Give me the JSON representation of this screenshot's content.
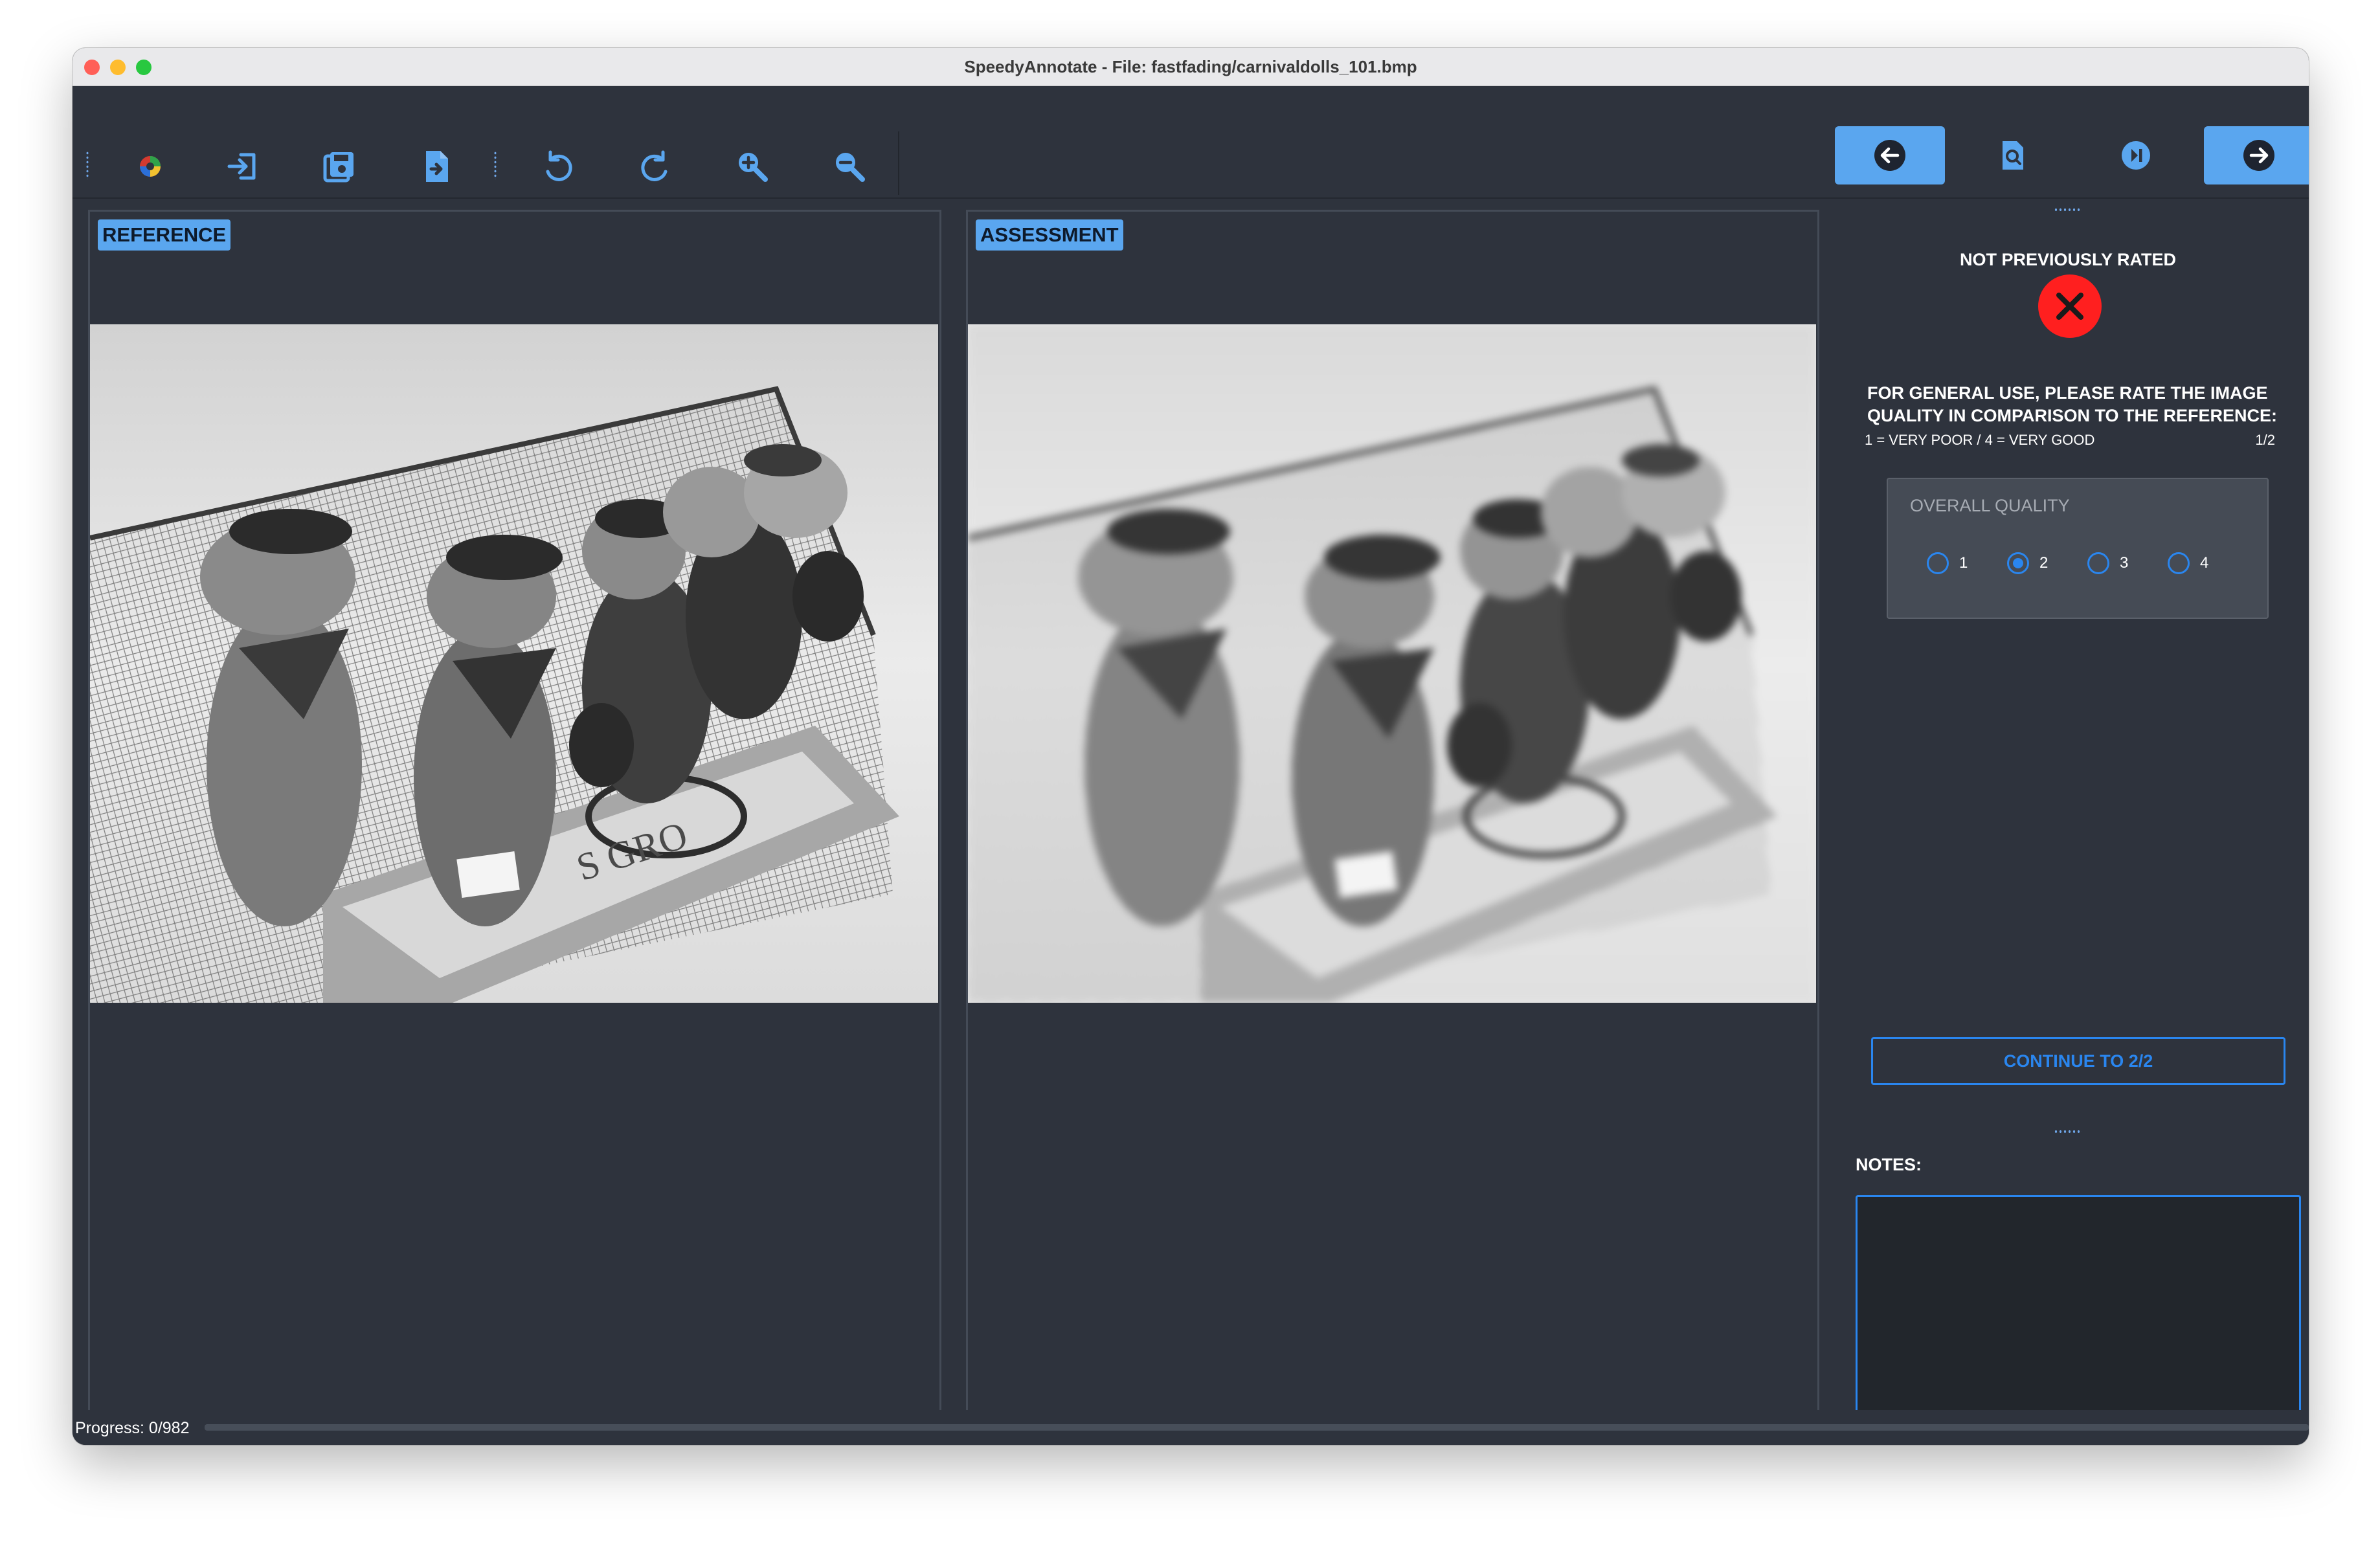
{
  "window": {
    "title": "SpeedyAnnotate - File: fastfading/carnivaldolls_101.bmp"
  },
  "toolbar": {
    "left_icons": [
      "app-logo-icon",
      "import-icon",
      "save-icon",
      "export-file-icon",
      "rotate-left-icon",
      "rotate-right-icon",
      "zoom-in-icon",
      "zoom-out-icon"
    ],
    "nav_buttons": [
      "arrow-left-icon",
      "search-icon",
      "skip-next-icon",
      "arrow-right-icon"
    ]
  },
  "reference": {
    "label": "REFERENCE",
    "progress": 0.8
  },
  "assessment": {
    "label": "ASSESSMENT",
    "progress": 0.8
  },
  "rating": {
    "status": "NOT PREVIOUSLY RATED",
    "prompt": "FOR GENERAL USE, PLEASE RATE THE IMAGE QUALITY IN COMPARISON TO THE REFERENCE:",
    "scale": "1 = VERY POOR  /  4 = VERY GOOD",
    "step": "1/2",
    "group_label": "OVERALL QUALITY",
    "options": [
      "1",
      "2",
      "3",
      "4"
    ],
    "selected": "2",
    "continue_label": "CONTINUE TO 2/2"
  },
  "notes": {
    "label": "NOTES:",
    "value": ""
  },
  "status": {
    "progress_text": "Progress: 0/982",
    "progress": 0
  },
  "colors": {
    "accent": "#2a86ef",
    "label_bg": "#5aa6ef",
    "panel_bg": "#2e333d",
    "error": "#ff1f1f"
  }
}
